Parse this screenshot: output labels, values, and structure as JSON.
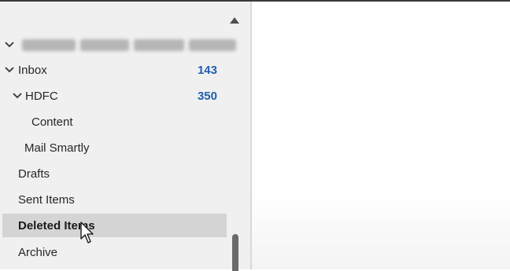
{
  "account": {
    "name": ""
  },
  "folders": [
    {
      "label": "Inbox",
      "count": "143"
    },
    {
      "label": "HDFC",
      "count": "350"
    },
    {
      "label": "Content"
    },
    {
      "label": "Mail Smartly"
    },
    {
      "label": "Drafts"
    },
    {
      "label": "Sent Items"
    },
    {
      "label": "Deleted Items"
    },
    {
      "label": "Archive"
    }
  ],
  "colors": {
    "pane_background": "#f0f0f0",
    "selected_row": "#d4d4d4",
    "count_text": "#1f5fae"
  },
  "icons": {
    "expand": "chevron-down-icon",
    "scroll_up": "triangle-up-icon",
    "pointer": "mouse-pointer-icon"
  }
}
